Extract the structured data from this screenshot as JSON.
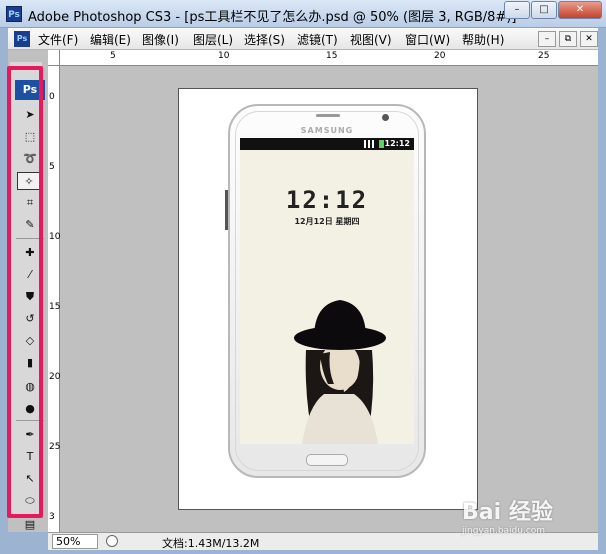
{
  "window": {
    "app_icon": "Ps",
    "title": "Adobe Photoshop CS3 - [ps工具栏不见了怎么办.psd @ 50% (图层 3, RGB/8#)]",
    "buttons": {
      "minimize": "–",
      "maximize": "□",
      "close": "✕"
    }
  },
  "menubar": {
    "doc_icon": "Ps",
    "items": [
      "文件(F)",
      "编辑(E)",
      "图像(I)",
      "图层(L)",
      "选择(S)",
      "滤镜(T)",
      "视图(V)",
      "窗口(W)",
      "帮助(H)"
    ],
    "mdi_buttons": {
      "minimize": "–",
      "restore": "⧉",
      "close": "✕"
    }
  },
  "rulers": {
    "top_labels": [
      "5",
      "10",
      "15",
      "20",
      "25"
    ],
    "left_labels": [
      "0",
      "5",
      "10",
      "15",
      "20",
      "25",
      "3"
    ]
  },
  "toolbox": {
    "logo": "Ps",
    "tools": [
      {
        "name": "move-tool",
        "glyph": "➤"
      },
      {
        "name": "marquee-tool",
        "glyph": "⬚"
      },
      {
        "name": "lasso-tool",
        "glyph": "➰"
      },
      {
        "name": "magic-wand-tool",
        "glyph": "✧",
        "active": true
      },
      {
        "name": "crop-tool",
        "glyph": "⌗"
      },
      {
        "name": "slice-tool",
        "glyph": "✎"
      },
      {
        "name": "healing-brush-tool",
        "glyph": "✚"
      },
      {
        "name": "brush-tool",
        "glyph": "⁄"
      },
      {
        "name": "clone-stamp-tool",
        "glyph": "⛊"
      },
      {
        "name": "history-brush-tool",
        "glyph": "↺"
      },
      {
        "name": "eraser-tool",
        "glyph": "◇"
      },
      {
        "name": "gradient-tool",
        "glyph": "▮"
      },
      {
        "name": "blur-tool",
        "glyph": "◍"
      },
      {
        "name": "dodge-tool",
        "glyph": "●"
      },
      {
        "name": "pen-tool",
        "glyph": "✒"
      },
      {
        "name": "type-tool",
        "glyph": "T"
      },
      {
        "name": "path-selection-tool",
        "glyph": "↖"
      },
      {
        "name": "shape-tool",
        "glyph": "⬭"
      },
      {
        "name": "notes-tool",
        "glyph": "▤"
      }
    ]
  },
  "phone": {
    "brand": "SAMSUNG",
    "status_time": "12:12",
    "clock": "12:12",
    "date": "12月12日 星期四"
  },
  "statusbar": {
    "zoom": "50%",
    "doc_size": "文档:1.43M/13.2M"
  },
  "watermark": {
    "brand": "Bai 经验",
    "url": "jingyan.baidu.com"
  },
  "colors": {
    "highlight": "#e8185c",
    "ps_blue": "#1d4fa3",
    "canvas_bg": "#c0c0c0"
  }
}
